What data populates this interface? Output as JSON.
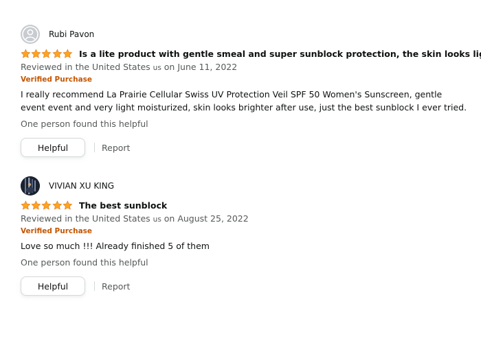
{
  "colors": {
    "star": "#ffa41c",
    "star_outline": "#de7921",
    "verified": "#c45500",
    "muted_text": "#565959"
  },
  "reviews": [
    {
      "reviewer_name": "Rubi Pavon",
      "avatar": "default-user-icon",
      "rating": 5,
      "title": "Is a lite product with gentle smeal and super sunblock protection, the skin looks lighter",
      "date_prefix": "Reviewed in the United States ",
      "country_code": "us",
      "date_suffix": " on June 11, 2022",
      "verified_label": "Verified Purchase",
      "body": "I really recommend La Prairie Cellular Swiss UV Protection Veil SPF 50 Women's Sunscreen, gentle event event and very light moisturized, skin looks brighter after use, just the best sunblock I ever tried.",
      "helpful_count": "One person found this helpful",
      "helpful_label": "Helpful",
      "report_label": "Report"
    },
    {
      "reviewer_name": "VIVIAN XU KING",
      "avatar": "photo-avatar",
      "rating": 5,
      "title": "The best sunblock",
      "date_prefix": "Reviewed in the United States ",
      "country_code": "us",
      "date_suffix": " on August 25, 2022",
      "verified_label": "Verified Purchase",
      "body": "Love so much !!! Already finished 5 of them",
      "helpful_count": "One person found this helpful",
      "helpful_label": "Helpful",
      "report_label": "Report"
    }
  ]
}
